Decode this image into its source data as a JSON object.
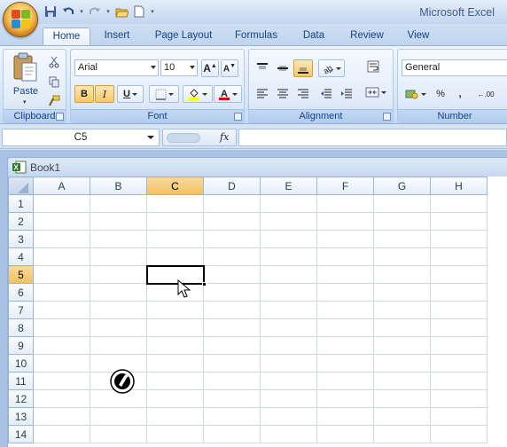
{
  "app": {
    "title": "Microsoft Excel"
  },
  "tabs": [
    {
      "label": "Home",
      "active": true
    },
    {
      "label": "Insert",
      "active": false
    },
    {
      "label": "Page Layout",
      "active": false
    },
    {
      "label": "Formulas",
      "active": false
    },
    {
      "label": "Data",
      "active": false
    },
    {
      "label": "Review",
      "active": false
    },
    {
      "label": "View",
      "active": false
    }
  ],
  "ribbon": {
    "clipboard": {
      "label": "Clipboard",
      "paste_label": "Paste"
    },
    "font": {
      "label": "Font",
      "font_name": "Arial",
      "font_size": "10",
      "bold": "B",
      "italic": "I",
      "underline": "U"
    },
    "alignment": {
      "label": "Alignment"
    },
    "number": {
      "label": "Number",
      "format": "General",
      "percent": "%",
      "comma": ",",
      "decimal": ".00"
    }
  },
  "formula_bar": {
    "name_box": "C5",
    "fx": "fx",
    "formula": ""
  },
  "workbook": {
    "name": "Book1"
  },
  "grid": {
    "columns": [
      "A",
      "B",
      "C",
      "D",
      "E",
      "F",
      "G",
      "H"
    ],
    "rows": [
      "1",
      "2",
      "3",
      "4",
      "5",
      "6",
      "7",
      "8",
      "9",
      "10",
      "11",
      "12",
      "13",
      "14"
    ],
    "selected_cell": "C5"
  },
  "colors": {
    "accent": "#f1c15f",
    "header_bg": "#e4ecf7",
    "ribbon_bg": "#dde9f8"
  }
}
